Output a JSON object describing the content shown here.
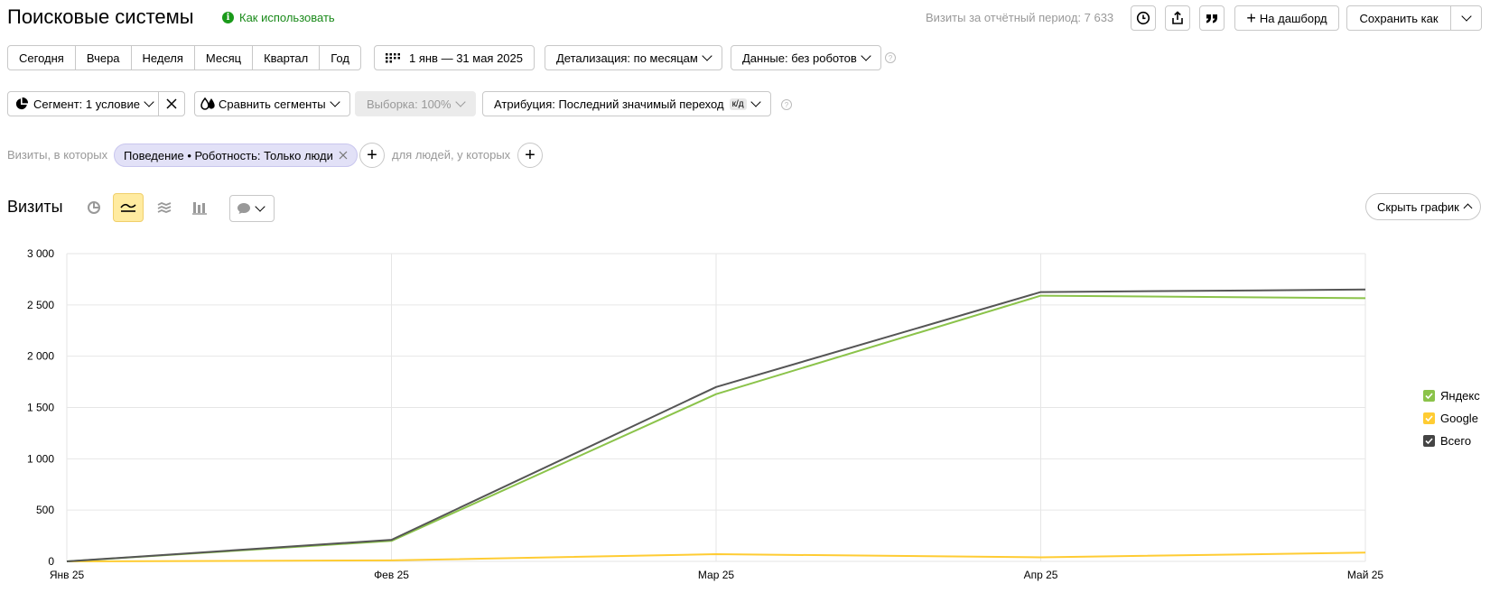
{
  "header": {
    "title": "Поисковые системы",
    "howto": "Как использовать",
    "visits_total": "Визиты за отчётный период: 7 633",
    "to_dashboard": "На дашборд",
    "save_as": "Сохранить как"
  },
  "period_buttons": [
    "Сегодня",
    "Вчера",
    "Неделя",
    "Месяц",
    "Квартал",
    "Год"
  ],
  "date_range": "1 янв — 31 мая 2025",
  "detail": "Детализация: по месяцам",
  "data_filter": "Данные: без роботов",
  "segment": "Сегмент: 1 условие",
  "compare": "Сравнить сегменты",
  "sample": "Выборка: 100%",
  "attribution": "Атрибуция: Последний значимый переход",
  "attribution_badge": "к/д",
  "filter_row": {
    "visits_label": "Визиты, в которых",
    "chip": "Поведение • Роботность: Только люди",
    "people_label": "для людей, у которых"
  },
  "chart_section": {
    "title": "Визиты",
    "hide_chart": "Скрыть график"
  },
  "chart_data": {
    "type": "line",
    "categories": [
      "Янв 25",
      "Фев 25",
      "Мар 25",
      "Апр 25",
      "Май 25"
    ],
    "ylim": [
      0,
      3000
    ],
    "yticks": [
      "0",
      "500",
      "1 000",
      "1 500",
      "2 000",
      "2 500",
      "3 000"
    ],
    "grid": true,
    "legend_position": "right",
    "series": [
      {
        "name": "Яндекс",
        "color": "#8bc34a",
        "values": [
          0,
          200,
          1630,
          2590,
          2565
        ]
      },
      {
        "name": "Google",
        "color": "#ffcc33",
        "values": [
          0,
          10,
          70,
          40,
          85
        ]
      },
      {
        "name": "Всего",
        "color": "#555555",
        "values": [
          0,
          210,
          1700,
          2625,
          2650
        ]
      }
    ]
  }
}
